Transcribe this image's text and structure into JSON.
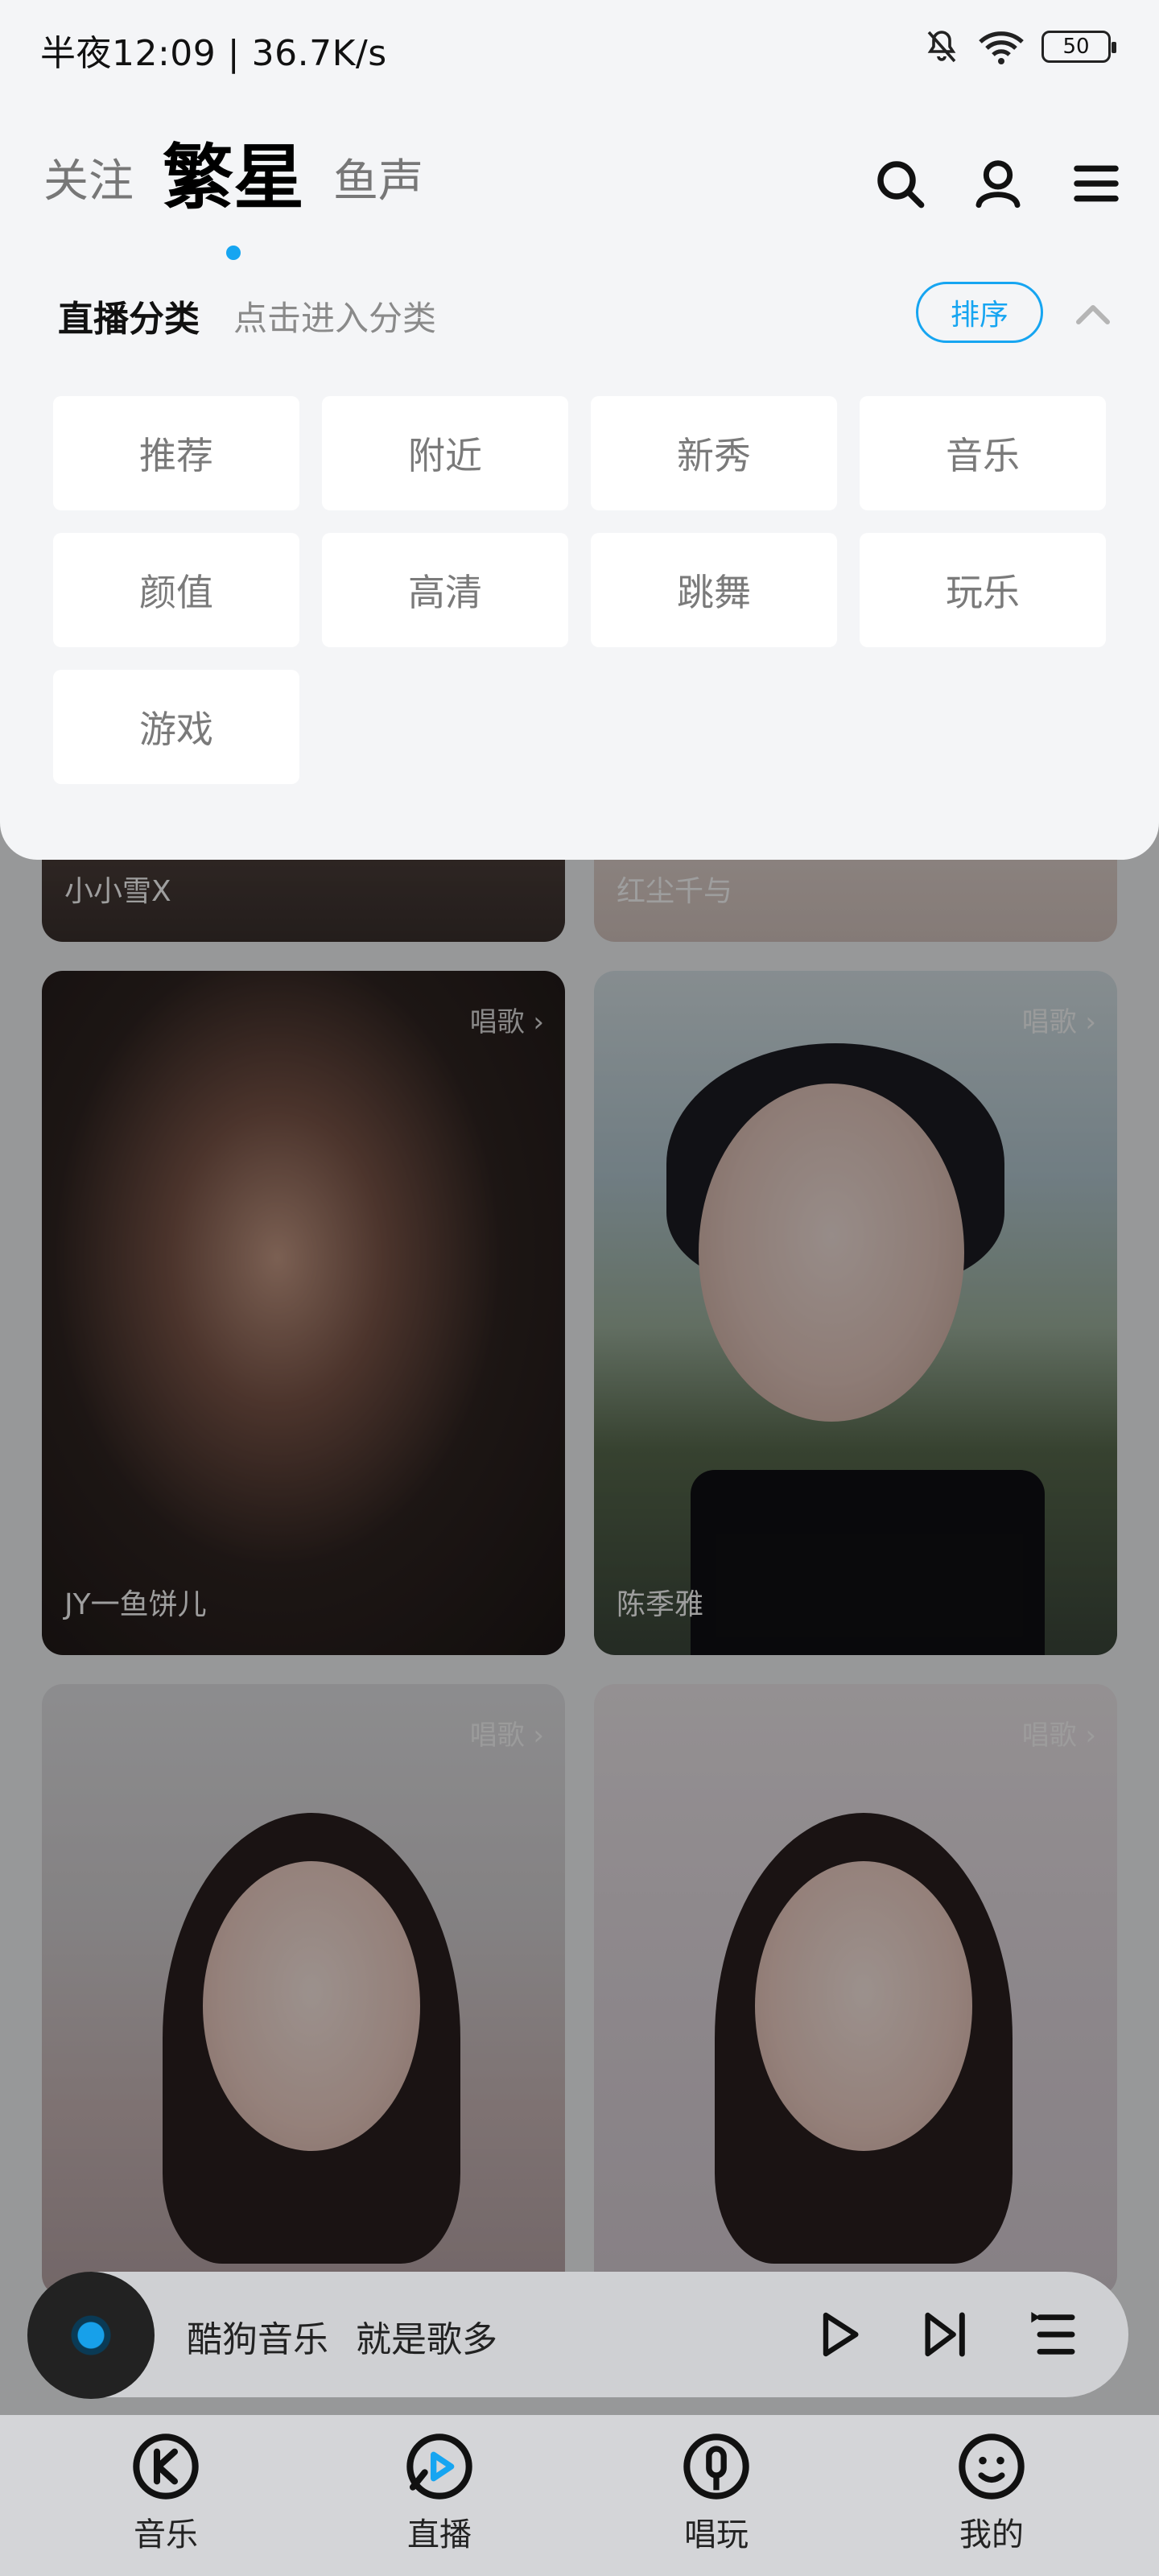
{
  "status_bar": {
    "time_speed": "半夜12:09 | 36.7K/s",
    "battery": "50"
  },
  "tabs": [
    {
      "label": "关注"
    },
    {
      "label": "繁星"
    },
    {
      "label": "鱼声"
    }
  ],
  "category": {
    "title": "直播分类",
    "hint": "点击进入分类",
    "sort_label": "排序",
    "items": [
      "推荐",
      "附近",
      "新秀",
      "音乐",
      "颜值",
      "高清",
      "跳舞",
      "玩乐",
      "游戏"
    ]
  },
  "feed": {
    "cards": [
      {
        "nick": "小小雪X",
        "tag": ""
      },
      {
        "nick": "红尘千与",
        "tag": ""
      },
      {
        "nick": "JY一鱼饼儿",
        "tag": "唱歌 ›"
      },
      {
        "nick": "陈季雅",
        "tag": "唱歌 ›"
      },
      {
        "nick": "",
        "tag": "唱歌 ›"
      },
      {
        "nick": "",
        "tag": "唱歌 ›"
      }
    ]
  },
  "player": {
    "title": "酷狗音乐",
    "subtitle": "就是歌多"
  },
  "bottom_nav": [
    {
      "label": "音乐",
      "icon": "music-icon"
    },
    {
      "label": "直播",
      "icon": "live-icon"
    },
    {
      "label": "唱玩",
      "icon": "sing-icon"
    },
    {
      "label": "我的",
      "icon": "me-icon"
    }
  ],
  "colors": {
    "accent": "#16a5f1"
  }
}
